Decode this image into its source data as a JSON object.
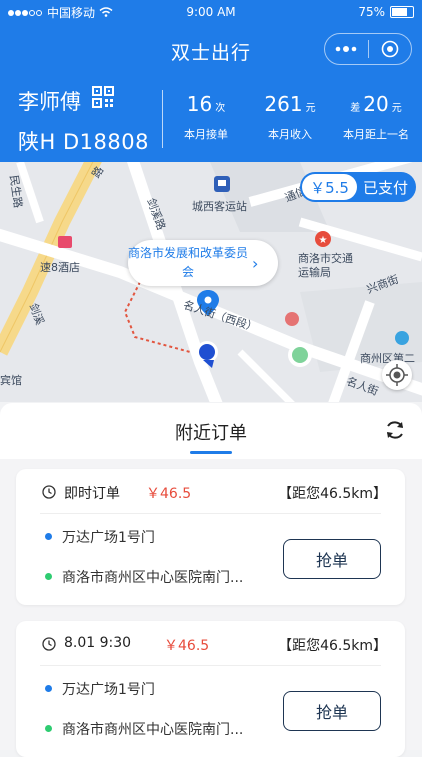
{
  "status": {
    "carrier": "中国移动",
    "time": "9:00 AM",
    "battery": "75%"
  },
  "nav": {
    "title": "双士出行",
    "more_icon": "more-dots-icon",
    "close_icon": "target-icon"
  },
  "driver": {
    "name": "李师傅",
    "plate": "陕H  D18808"
  },
  "stats": [
    {
      "prefix": "",
      "value": "16",
      "unit": "次",
      "label": "本月接单"
    },
    {
      "prefix": "",
      "value": "261",
      "unit": "元",
      "label": "本月收入"
    },
    {
      "prefix": "差",
      "value": "20",
      "unit": "元",
      "label": "本月距上一名"
    }
  ],
  "map": {
    "paid_amount": "￥5.5",
    "paid_text": "已支付",
    "callout": "商洛市发展和改革委员会",
    "labels": {
      "minsheng": "民生路",
      "tongxin": "通信巷",
      "bus_station": "城西客运站",
      "jianxue": "剑溪路",
      "jianwen": "剑溪",
      "hotel": "速8酒店",
      "transport_bureau": "商洛市交通运输局",
      "xingshang": "兴商街",
      "mingren_west": "名人街（西段）",
      "shangzhou": "商州区第二",
      "mingren": "名人街",
      "guan": "宾馆",
      "road_lu": "路",
      "jianxue2": "剑溪路"
    }
  },
  "orders_tab": {
    "title": "附近订单"
  },
  "orders": [
    {
      "time": "即时订单",
      "price": "￥46.5",
      "distance": "【距您46.5km】",
      "from": "万达广场1号门",
      "to": "商洛市商州区中心医院南门...",
      "button": "抢单"
    },
    {
      "time": "8.01  9:30",
      "price": "￥46.5",
      "distance": "【距您46.5km】",
      "from": "万达广场1号门",
      "to": "商洛市商州区中心医院南门...",
      "button": "抢单"
    }
  ],
  "colors": {
    "primary": "#1f7ce8",
    "price": "#e74c3c",
    "from_dot": "#1f7ce8",
    "to_dot": "#2ecc71"
  }
}
